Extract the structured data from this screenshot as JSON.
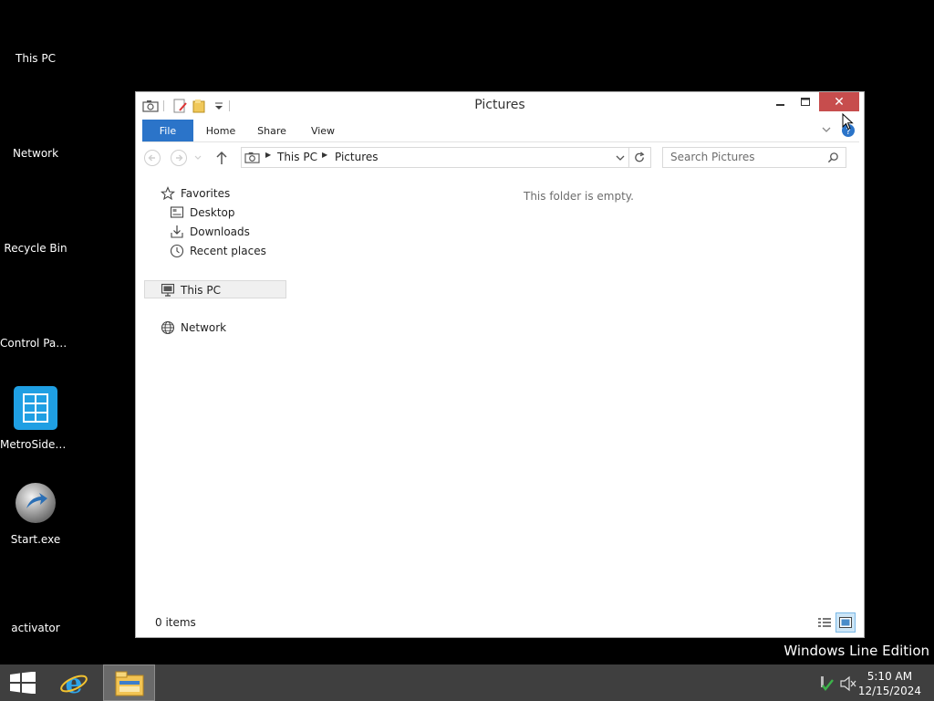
{
  "desktop": {
    "icons": [
      {
        "label": "This PC"
      },
      {
        "label": "Network"
      },
      {
        "label": "Recycle Bin"
      },
      {
        "label": "Control Panel"
      },
      {
        "label": "MetroSideb..."
      },
      {
        "label": "Start.exe"
      },
      {
        "label": "activator"
      }
    ],
    "watermark": "Windows Line Edition"
  },
  "window": {
    "title": "Pictures",
    "close_glyph": "✕",
    "ribbon_tabs": [
      "File",
      "Home",
      "Share",
      "View"
    ],
    "address": {
      "crumbs": [
        "This PC",
        "Pictures"
      ]
    },
    "search_placeholder": "Search Pictures",
    "nav": {
      "favorites": "Favorites",
      "desktop": "Desktop",
      "downloads": "Downloads",
      "recent": "Recent places",
      "this_pc": "This PC",
      "network": "Network"
    },
    "empty_message": "This folder is empty.",
    "status": "0 items"
  },
  "taskbar": {
    "time": "5:10 AM",
    "date": "12/15/2024"
  },
  "colors": {
    "accent": "#2b74c9",
    "close": "#c74d4d",
    "taskbar": "#3f3f3f"
  }
}
